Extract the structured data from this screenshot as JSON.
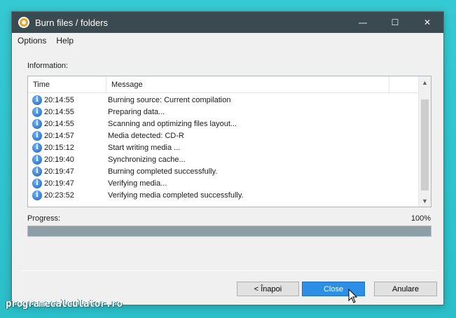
{
  "window": {
    "title": "Burn files / folders",
    "minimize_glyph": "—",
    "maximize_glyph": "☐",
    "close_glyph": "✕"
  },
  "menu": {
    "items": [
      {
        "label": "Options"
      },
      {
        "label": "Help"
      }
    ]
  },
  "information": {
    "label": "Information:",
    "columns": {
      "time": "Time",
      "message": "Message"
    },
    "rows": [
      {
        "time": "20:14:55",
        "message": "Burning source:  Current compilation"
      },
      {
        "time": "20:14:55",
        "message": "Preparing data..."
      },
      {
        "time": "20:14:55",
        "message": "Scanning and optimizing files layout..."
      },
      {
        "time": "20:14:57",
        "message": "Media detected: CD-R"
      },
      {
        "time": "20:15:12",
        "message": "Start writing media ..."
      },
      {
        "time": "20:19:40",
        "message": "Synchronizing cache..."
      },
      {
        "time": "20:19:47",
        "message": "Burning completed successfully."
      },
      {
        "time": "20:19:47",
        "message": "Verifying media..."
      },
      {
        "time": "20:23:52",
        "message": "Verifying media completed successfully."
      }
    ],
    "row_icon": "info-icon"
  },
  "progress": {
    "label": "Progress:",
    "percent_text": "100%",
    "value": 100
  },
  "buttons": {
    "back": "< Înapoi",
    "close": "Close",
    "cancel": "Anulare"
  },
  "watermark": "programecalculator.ro",
  "colors": {
    "titlebar": "#3b4950",
    "accent": "#2d8ee6",
    "progress_fill": "#8e9ea6",
    "background": "#2ec5cf"
  }
}
